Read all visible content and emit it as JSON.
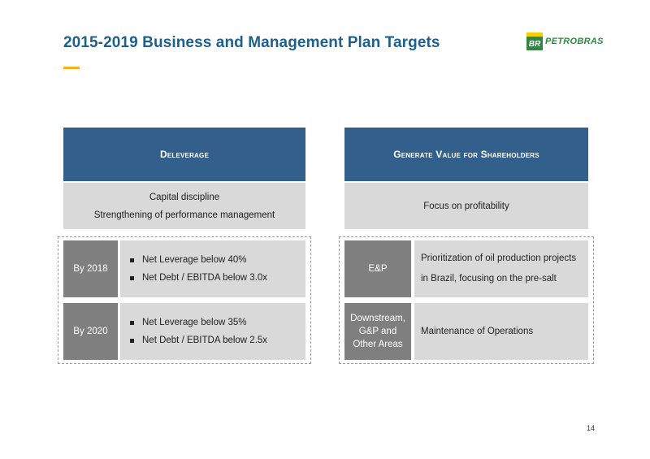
{
  "title": "2015-2019 Business and Management Plan Targets",
  "logo": {
    "text": "PETROBRAS",
    "mark": "BR"
  },
  "left": {
    "header": "Deleverage",
    "sub_lines": [
      "Capital discipline",
      "Strengthening of performance management"
    ],
    "rows": [
      {
        "label": "By 2018",
        "bullets": [
          "Net Leverage below 40%",
          "Net Debt / EBITDA below 3.0x"
        ]
      },
      {
        "label": "By 2020",
        "bullets": [
          "Net Leverage below 35%",
          "Net Debt / EBITDA below 2.5x"
        ]
      }
    ]
  },
  "right": {
    "header": "Generate Value for Shareholders",
    "sub_lines": [
      "Focus on profitability"
    ],
    "rows": [
      {
        "label": "E&P",
        "text": "Prioritization of oil production projects in Brazil, focusing on the pre-salt"
      },
      {
        "label": "Downstream, G&P and Other Areas",
        "text": "Maintenance of Operations"
      }
    ]
  },
  "page_number": "14",
  "colors": {
    "title": "#1f5f8b",
    "header_bg": "#335f8d",
    "sub_bg": "#d9d9d9",
    "label_bg": "#7f7f7f",
    "accent": "#f4b321",
    "logo_green": "#2c8a3e"
  }
}
